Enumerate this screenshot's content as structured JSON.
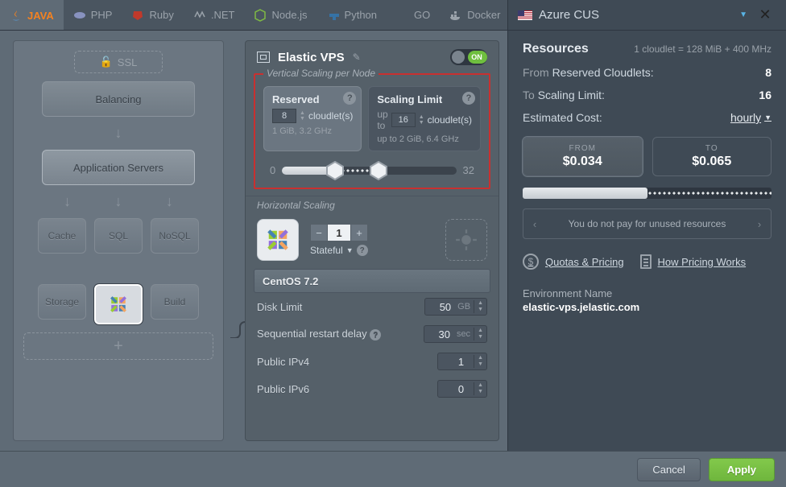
{
  "tabs": {
    "java": "JAVA",
    "php": "PHP",
    "ruby": "Ruby",
    "dotnet": ".NET",
    "node": "Node.js",
    "python": "Python",
    "go": "GO",
    "docker": "Docker"
  },
  "region": {
    "label": "Azure CUS"
  },
  "palette": {
    "ssl": "SSL",
    "balancing": "Balancing",
    "app_servers": "Application Servers",
    "cache": "Cache",
    "sql": "SQL",
    "nosql": "NoSQL",
    "storage": "Storage",
    "build": "Build",
    "add": "+"
  },
  "config": {
    "title": "Elastic VPS",
    "toggle_on": "ON",
    "vscale_label": "Vertical Scaling per Node",
    "reserved": {
      "title": "Reserved",
      "value": "8",
      "unit": "cloudlet(s)",
      "detail": "1 GiB, 3.2 GHz"
    },
    "limit": {
      "title": "Scaling Limit",
      "prefix": "up to",
      "value": "16",
      "unit": "cloudlet(s)",
      "detail_prefix": "up to",
      "detail": "2 GiB, 6.4 GHz"
    },
    "slider": {
      "min": "0",
      "max": "32"
    },
    "hscale_label": "Horizontal Scaling",
    "count": "1",
    "stateful": "Stateful",
    "os": "CentOS 7.2",
    "disk_limit": {
      "label": "Disk Limit",
      "value": "50",
      "unit": "GB"
    },
    "restart_delay": {
      "label": "Sequential restart delay",
      "value": "30",
      "unit": "sec"
    },
    "ipv4": {
      "label": "Public IPv4",
      "value": "1"
    },
    "ipv6": {
      "label": "Public IPv6",
      "value": "0"
    }
  },
  "right": {
    "resources_title": "Resources",
    "cloudlet_note": "1 cloudlet = 128 MiB + 400 MHz",
    "from_label": "From",
    "reserved_label": "Reserved Cloudlets:",
    "reserved_value": "8",
    "to_label": "To",
    "limit_label": "Scaling Limit:",
    "limit_value": "16",
    "est_cost": "Estimated Cost:",
    "period": "hourly",
    "from_box_label": "FROM",
    "from_box_value": "$0.034",
    "to_box_label": "TO",
    "to_box_value": "$0.065",
    "carousel": "You do not pay for unused resources",
    "link_quotas": "Quotas & Pricing",
    "link_how": "How Pricing Works",
    "env_label": "Environment Name",
    "env_value": "elastic-vps.jelastic.com"
  },
  "footer": {
    "cancel": "Cancel",
    "apply": "Apply"
  }
}
